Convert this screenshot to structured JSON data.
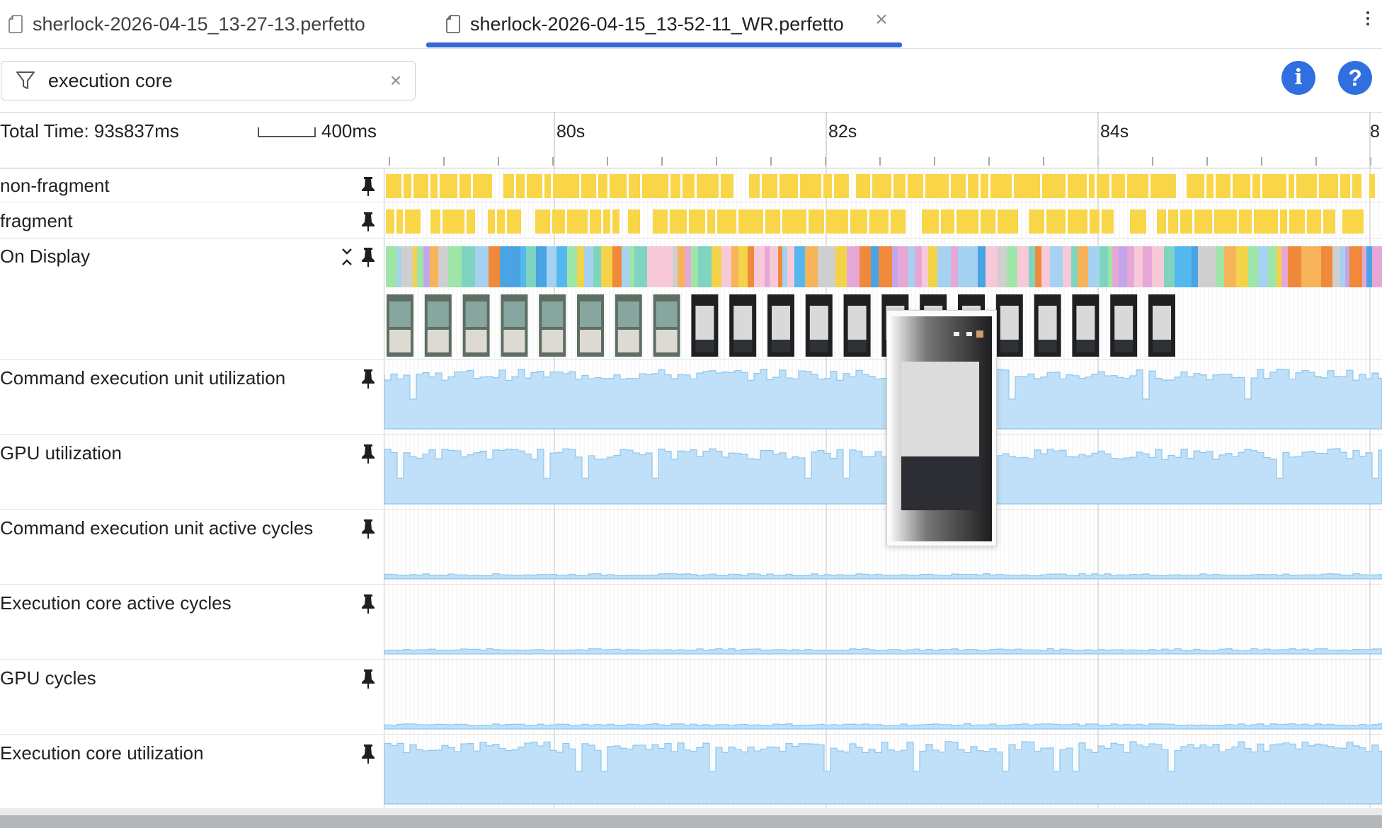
{
  "tabs": [
    {
      "label": "sherlock-2026-04-15_13-27-13.perfetto",
      "active": false,
      "icon": "file-icon"
    },
    {
      "label": "sherlock-2026-04-15_13-52-11_WR.perfetto",
      "active": true,
      "icon": "file-icon",
      "close_icon": "close-icon"
    }
  ],
  "toolbar": {
    "filter_value": "execution core",
    "filter_icon": "filter-icon",
    "clear_symbol": "×",
    "info_symbol": "i",
    "help_symbol": "?"
  },
  "timeline": {
    "total_time": "Total Time: 93s837ms",
    "scale_label": "400ms",
    "ticks": [
      "80s",
      "82s",
      "84s",
      "8"
    ],
    "tracks": [
      {
        "label": "non-fragment",
        "type": "slices",
        "color": "#f9d548"
      },
      {
        "label": "fragment",
        "type": "slices",
        "color": "#f9d548"
      },
      {
        "label": "On Display",
        "type": "frames",
        "collapsible": true
      },
      {
        "label": "Command execution unit utilization",
        "type": "counter",
        "level": 0.78
      },
      {
        "label": "GPU utilization",
        "type": "counter",
        "level": 0.72
      },
      {
        "label": "Command execution unit active cycles",
        "type": "counter",
        "level": 0.06
      },
      {
        "label": "Execution core active cycles",
        "type": "counter",
        "level": 0.06
      },
      {
        "label": "GPU cycles",
        "type": "counter",
        "level": 0.06
      },
      {
        "label": "Execution core utilization",
        "type": "counter",
        "level": 0.82
      }
    ]
  },
  "colors": {
    "accent": "#3767d8",
    "slice_yellow": "#f9d548",
    "counter_fill": "#bfe0f8",
    "counter_line": "#8cc6ee",
    "button_blue": "#2f6fe0"
  }
}
